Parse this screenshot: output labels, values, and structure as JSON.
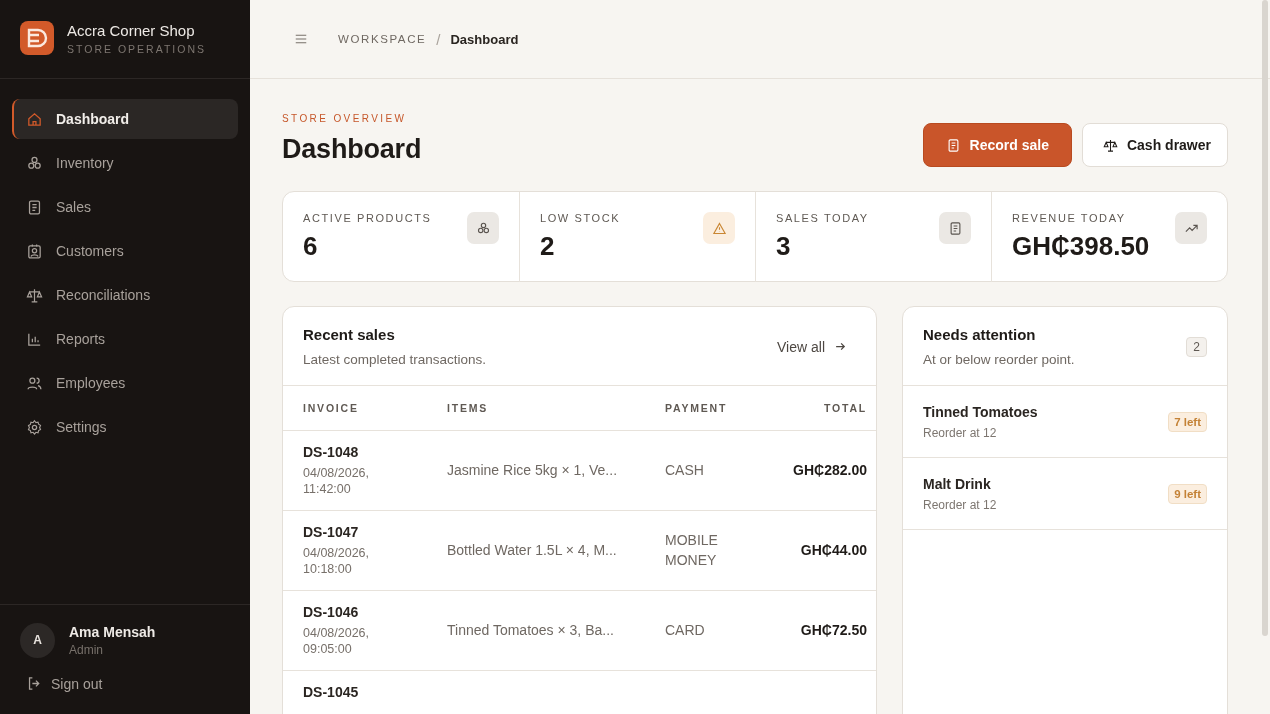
{
  "brand": {
    "name": "Accra Corner Shop",
    "tagline": "STORE OPERATIONS"
  },
  "nav": [
    {
      "label": "Dashboard",
      "selected": true
    },
    {
      "label": "Inventory",
      "selected": false
    },
    {
      "label": "Sales",
      "selected": false
    },
    {
      "label": "Customers",
      "selected": false
    },
    {
      "label": "Reconciliations",
      "selected": false
    },
    {
      "label": "Reports",
      "selected": false
    },
    {
      "label": "Employees",
      "selected": false
    },
    {
      "label": "Settings",
      "selected": false
    }
  ],
  "user": {
    "initial": "A",
    "name": "Ama Mensah",
    "role": "Admin"
  },
  "sign_out": "Sign out",
  "breadcrumb": {
    "parent": "WORKSPACE",
    "separator": "/",
    "current": "Dashboard"
  },
  "header": {
    "eyebrow": "STORE OVERVIEW",
    "title": "Dashboard"
  },
  "buttons": [
    {
      "label": "Record sale",
      "kind": "primary"
    },
    {
      "label": "Cash drawer",
      "kind": "secondary"
    }
  ],
  "stats": [
    {
      "label": "ACTIVE PRODUCTS",
      "value": "6",
      "kind": "plain"
    },
    {
      "label": "LOW STOCK",
      "value": "2",
      "kind": "alert"
    },
    {
      "label": "SALES TODAY",
      "value": "3",
      "kind": "plain"
    },
    {
      "label": "REVENUE TODAY",
      "value": "GH₵398.50",
      "kind": "plain"
    }
  ],
  "recent_sales": {
    "title": "Recent sales",
    "subtitle": "Latest completed transactions.",
    "link": "View all",
    "columns": [
      "INVOICE",
      "ITEMS",
      "PAYMENT",
      "TOTAL"
    ],
    "rows": [
      {
        "invoice": "DS-1048",
        "date": "04/08/2026, 11:42:00",
        "items": "Jasmine Rice 5kg × 1, Ve...",
        "payment": "CASH",
        "total": "GH₵282.00"
      },
      {
        "invoice": "DS-1047",
        "date": "04/08/2026, 10:18:00",
        "items": "Bottled Water 1.5L × 4, M...",
        "payment": "MOBILE MONEY",
        "total": "GH₵44.00"
      },
      {
        "invoice": "DS-1046",
        "date": "04/08/2026, 09:05:00",
        "items": "Tinned Tomatoes × 3, Ba...",
        "payment": "CARD",
        "total": "GH₵72.50"
      },
      {
        "invoice": "DS-1045"
      }
    ]
  },
  "attention": {
    "title": "Needs attention",
    "subtitle": "At or below reorder point.",
    "count": "2",
    "items": [
      {
        "name": "Tinned Tomatoes",
        "note": "Reorder at 12",
        "badge": "7 left"
      },
      {
        "name": "Malt Drink",
        "note": "Reorder at 12",
        "badge": "9 left"
      }
    ]
  }
}
